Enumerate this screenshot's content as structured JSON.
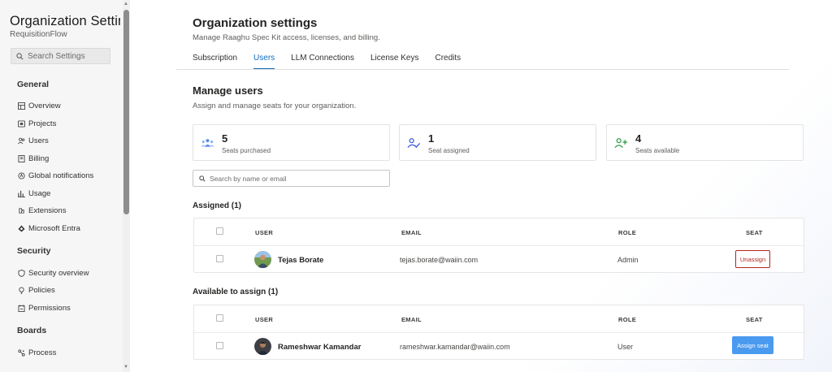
{
  "sidebar": {
    "title": "Organization Settings",
    "subtitle": "RequisitionFlow",
    "search_placeholder": "Search Settings",
    "sections": {
      "general": "General",
      "security": "Security",
      "boards": "Boards"
    },
    "general_items": [
      "Overview",
      "Projects",
      "Users",
      "Billing",
      "Global notifications",
      "Usage",
      "Extensions",
      "Microsoft Entra"
    ],
    "security_items": [
      "Security overview",
      "Policies",
      "Permissions"
    ],
    "boards_items": [
      "Process"
    ]
  },
  "header": {
    "title": "Organization settings",
    "description": "Manage Raaghu Spec Kit access, licenses, and billing."
  },
  "tabs": [
    "Subscription",
    "Users",
    "LLM Connections",
    "License Keys",
    "Credits"
  ],
  "active_tab": "Users",
  "manage": {
    "title": "Manage users",
    "description": "Assign and manage seats for your organization."
  },
  "stats": {
    "purchased": {
      "value": "5",
      "label": "Seats purchased"
    },
    "assigned": {
      "value": "1",
      "label": "Seat assigned"
    },
    "available": {
      "value": "4",
      "label": "Seats available"
    }
  },
  "user_search_placeholder": "Search by name or email",
  "columns": {
    "user": "USER",
    "email": "EMAIL",
    "role": "ROLE",
    "seat": "SEAT"
  },
  "assigned": {
    "title": "Assigned (1)",
    "rows": [
      {
        "name": "Tejas Borate",
        "email": "tejas.borate@waiin.com",
        "role": "Admin",
        "action": "Unassign"
      }
    ]
  },
  "available": {
    "title": "Available to assign (1)",
    "rows": [
      {
        "name": "Rameshwar Kamandar",
        "email": "rameshwar.kamandar@waiin.com",
        "role": "User",
        "action": "Assign seat"
      }
    ]
  },
  "colors": {
    "accent": "#0f6cbd",
    "assign_button": "#4a9af0",
    "unassign_border": "#b3261e",
    "purchased_icon": "#5b8def",
    "assigned_icon": "#3b5bdb",
    "available_icon": "#2f9e44"
  }
}
